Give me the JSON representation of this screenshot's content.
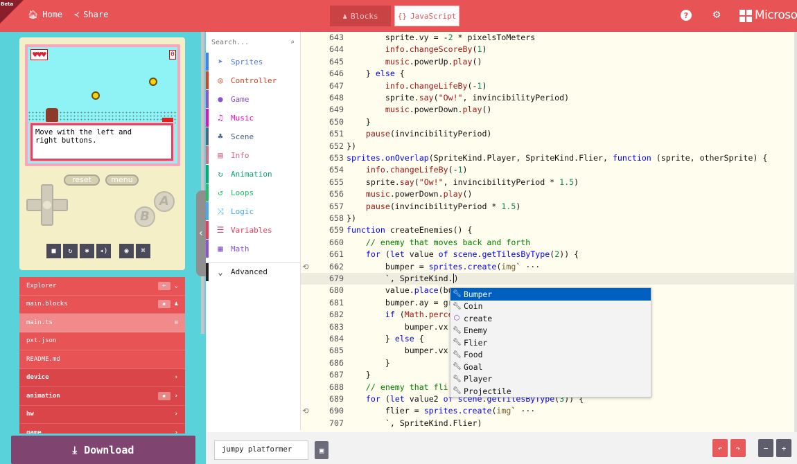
{
  "topbar": {
    "beta": "Beta",
    "home": "Home",
    "share": "Share",
    "tab_blocks": "Blocks",
    "tab_js": "JavaScript",
    "brand": "Microsoft"
  },
  "simulator": {
    "dialog_line1": "Move with the left and",
    "dialog_line2": "right buttons.",
    "hearts": "♥♥♥",
    "score": "0",
    "reset": "reset",
    "menu": "menu",
    "btn_a": "A",
    "btn_b": "B"
  },
  "explorer": {
    "rows": [
      {
        "label": "Explorer"
      },
      {
        "label": "main.blocks"
      },
      {
        "label": "main.ts"
      },
      {
        "label": "pxt.json"
      },
      {
        "label": "README.md"
      },
      {
        "label": "device"
      },
      {
        "label": "animation"
      },
      {
        "label": "hw"
      },
      {
        "label": "game"
      }
    ]
  },
  "download": "Download",
  "toolbox": {
    "search_placeholder": "Search...",
    "items": [
      {
        "label": "Sprites",
        "color": "#4b7bec",
        "icon": "paper-plane-icon"
      },
      {
        "label": "Controller",
        "color": "#d54322",
        "icon": "gamepad-icon"
      },
      {
        "label": "Game",
        "color": "#8854d0",
        "icon": "circle-icon"
      },
      {
        "label": "Music",
        "color": "#e30fc0",
        "icon": "headphones-icon"
      },
      {
        "label": "Scene",
        "color": "#4b6584",
        "icon": "tree-icon"
      },
      {
        "label": "Info",
        "color": "#cf6a87",
        "icon": "id-card-icon"
      },
      {
        "label": "Animation",
        "color": "#03aa74",
        "icon": "refresh-icon"
      },
      {
        "label": "Loops",
        "color": "#20bf6b",
        "icon": "loop-icon"
      },
      {
        "label": "Logic",
        "color": "#45aaf2",
        "icon": "shuffle-icon"
      },
      {
        "label": "Variables",
        "color": "#eb3b5a",
        "icon": "list-icon"
      },
      {
        "label": "Math",
        "color": "#8854d0",
        "icon": "calculator-icon"
      },
      {
        "label": "Advanced",
        "color": "#222222",
        "icon": "chevron-down-icon"
      }
    ]
  },
  "editor": {
    "line_numbers": [
      "643",
      "644",
      "645",
      "646",
      "647",
      "648",
      "649",
      "650",
      "651",
      "652",
      "653",
      "654",
      "655",
      "656",
      "657",
      "658",
      "659",
      "660",
      "661",
      "662",
      "679",
      "680",
      "681",
      "682",
      "683",
      "684",
      "685",
      "686",
      "687",
      "688",
      "689",
      "690",
      "707"
    ]
  },
  "autocomplete": {
    "items": [
      {
        "label": "Bumper",
        "icon": "wrench-icon"
      },
      {
        "label": "Coin",
        "icon": "wrench-icon"
      },
      {
        "label": "create",
        "icon": "cube-icon"
      },
      {
        "label": "Enemy",
        "icon": "wrench-icon"
      },
      {
        "label": "Flier",
        "icon": "wrench-icon"
      },
      {
        "label": "Food",
        "icon": "wrench-icon"
      },
      {
        "label": "Goal",
        "icon": "wrench-icon"
      },
      {
        "label": "Player",
        "icon": "wrench-icon"
      },
      {
        "label": "Projectile",
        "icon": "wrench-icon"
      }
    ]
  },
  "bottom": {
    "project_name": "jumpy platformer"
  }
}
